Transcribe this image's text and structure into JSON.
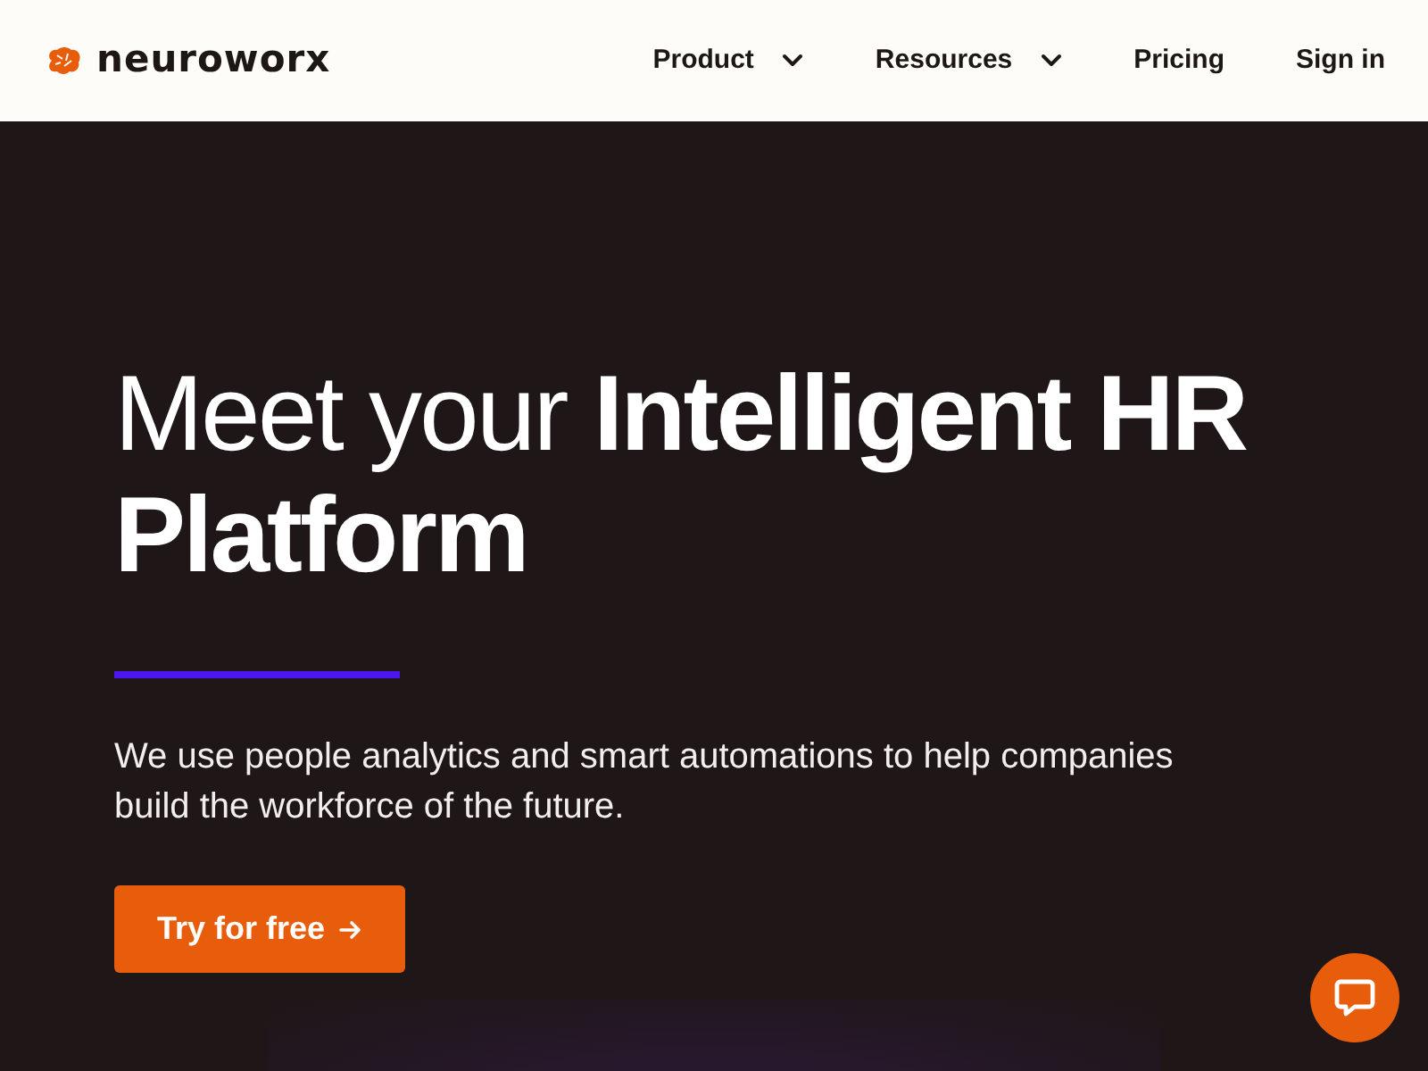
{
  "brand": {
    "name": "neuroworx"
  },
  "nav": [
    {
      "label": "Product",
      "kind": "dropdown"
    },
    {
      "label": "Resources",
      "kind": "dropdown"
    },
    {
      "label": "Pricing",
      "kind": "link"
    },
    {
      "label": "Sign in",
      "kind": "link"
    }
  ],
  "hero": {
    "heading": "Meet your **Intelligent HR Platform**",
    "text": "We use people analytics and smart automations to help companies build the workforce of the future.",
    "button": "Try for free"
  }
}
